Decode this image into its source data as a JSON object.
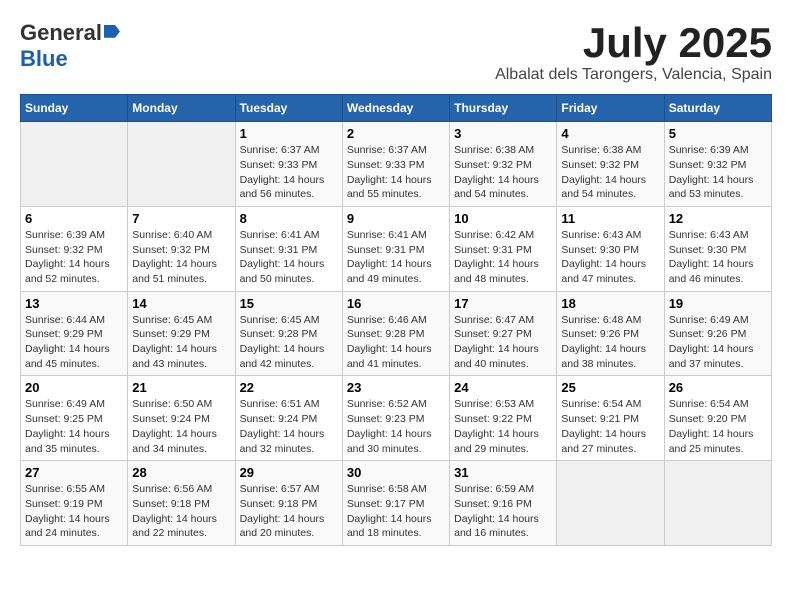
{
  "logo": {
    "general": "General",
    "blue": "Blue"
  },
  "title": {
    "month": "July 2025",
    "location": "Albalat dels Tarongers, Valencia, Spain"
  },
  "headers": [
    "Sunday",
    "Monday",
    "Tuesday",
    "Wednesday",
    "Thursday",
    "Friday",
    "Saturday"
  ],
  "weeks": [
    [
      {
        "num": "",
        "sunrise": "",
        "sunset": "",
        "daylight": "",
        "empty": true
      },
      {
        "num": "",
        "sunrise": "",
        "sunset": "",
        "daylight": "",
        "empty": true
      },
      {
        "num": "1",
        "sunrise": "Sunrise: 6:37 AM",
        "sunset": "Sunset: 9:33 PM",
        "daylight": "Daylight: 14 hours and 56 minutes.",
        "empty": false
      },
      {
        "num": "2",
        "sunrise": "Sunrise: 6:37 AM",
        "sunset": "Sunset: 9:33 PM",
        "daylight": "Daylight: 14 hours and 55 minutes.",
        "empty": false
      },
      {
        "num": "3",
        "sunrise": "Sunrise: 6:38 AM",
        "sunset": "Sunset: 9:32 PM",
        "daylight": "Daylight: 14 hours and 54 minutes.",
        "empty": false
      },
      {
        "num": "4",
        "sunrise": "Sunrise: 6:38 AM",
        "sunset": "Sunset: 9:32 PM",
        "daylight": "Daylight: 14 hours and 54 minutes.",
        "empty": false
      },
      {
        "num": "5",
        "sunrise": "Sunrise: 6:39 AM",
        "sunset": "Sunset: 9:32 PM",
        "daylight": "Daylight: 14 hours and 53 minutes.",
        "empty": false
      }
    ],
    [
      {
        "num": "6",
        "sunrise": "Sunrise: 6:39 AM",
        "sunset": "Sunset: 9:32 PM",
        "daylight": "Daylight: 14 hours and 52 minutes.",
        "empty": false
      },
      {
        "num": "7",
        "sunrise": "Sunrise: 6:40 AM",
        "sunset": "Sunset: 9:32 PM",
        "daylight": "Daylight: 14 hours and 51 minutes.",
        "empty": false
      },
      {
        "num": "8",
        "sunrise": "Sunrise: 6:41 AM",
        "sunset": "Sunset: 9:31 PM",
        "daylight": "Daylight: 14 hours and 50 minutes.",
        "empty": false
      },
      {
        "num": "9",
        "sunrise": "Sunrise: 6:41 AM",
        "sunset": "Sunset: 9:31 PM",
        "daylight": "Daylight: 14 hours and 49 minutes.",
        "empty": false
      },
      {
        "num": "10",
        "sunrise": "Sunrise: 6:42 AM",
        "sunset": "Sunset: 9:31 PM",
        "daylight": "Daylight: 14 hours and 48 minutes.",
        "empty": false
      },
      {
        "num": "11",
        "sunrise": "Sunrise: 6:43 AM",
        "sunset": "Sunset: 9:30 PM",
        "daylight": "Daylight: 14 hours and 47 minutes.",
        "empty": false
      },
      {
        "num": "12",
        "sunrise": "Sunrise: 6:43 AM",
        "sunset": "Sunset: 9:30 PM",
        "daylight": "Daylight: 14 hours and 46 minutes.",
        "empty": false
      }
    ],
    [
      {
        "num": "13",
        "sunrise": "Sunrise: 6:44 AM",
        "sunset": "Sunset: 9:29 PM",
        "daylight": "Daylight: 14 hours and 45 minutes.",
        "empty": false
      },
      {
        "num": "14",
        "sunrise": "Sunrise: 6:45 AM",
        "sunset": "Sunset: 9:29 PM",
        "daylight": "Daylight: 14 hours and 43 minutes.",
        "empty": false
      },
      {
        "num": "15",
        "sunrise": "Sunrise: 6:45 AM",
        "sunset": "Sunset: 9:28 PM",
        "daylight": "Daylight: 14 hours and 42 minutes.",
        "empty": false
      },
      {
        "num": "16",
        "sunrise": "Sunrise: 6:46 AM",
        "sunset": "Sunset: 9:28 PM",
        "daylight": "Daylight: 14 hours and 41 minutes.",
        "empty": false
      },
      {
        "num": "17",
        "sunrise": "Sunrise: 6:47 AM",
        "sunset": "Sunset: 9:27 PM",
        "daylight": "Daylight: 14 hours and 40 minutes.",
        "empty": false
      },
      {
        "num": "18",
        "sunrise": "Sunrise: 6:48 AM",
        "sunset": "Sunset: 9:26 PM",
        "daylight": "Daylight: 14 hours and 38 minutes.",
        "empty": false
      },
      {
        "num": "19",
        "sunrise": "Sunrise: 6:49 AM",
        "sunset": "Sunset: 9:26 PM",
        "daylight": "Daylight: 14 hours and 37 minutes.",
        "empty": false
      }
    ],
    [
      {
        "num": "20",
        "sunrise": "Sunrise: 6:49 AM",
        "sunset": "Sunset: 9:25 PM",
        "daylight": "Daylight: 14 hours and 35 minutes.",
        "empty": false
      },
      {
        "num": "21",
        "sunrise": "Sunrise: 6:50 AM",
        "sunset": "Sunset: 9:24 PM",
        "daylight": "Daylight: 14 hours and 34 minutes.",
        "empty": false
      },
      {
        "num": "22",
        "sunrise": "Sunrise: 6:51 AM",
        "sunset": "Sunset: 9:24 PM",
        "daylight": "Daylight: 14 hours and 32 minutes.",
        "empty": false
      },
      {
        "num": "23",
        "sunrise": "Sunrise: 6:52 AM",
        "sunset": "Sunset: 9:23 PM",
        "daylight": "Daylight: 14 hours and 30 minutes.",
        "empty": false
      },
      {
        "num": "24",
        "sunrise": "Sunrise: 6:53 AM",
        "sunset": "Sunset: 9:22 PM",
        "daylight": "Daylight: 14 hours and 29 minutes.",
        "empty": false
      },
      {
        "num": "25",
        "sunrise": "Sunrise: 6:54 AM",
        "sunset": "Sunset: 9:21 PM",
        "daylight": "Daylight: 14 hours and 27 minutes.",
        "empty": false
      },
      {
        "num": "26",
        "sunrise": "Sunrise: 6:54 AM",
        "sunset": "Sunset: 9:20 PM",
        "daylight": "Daylight: 14 hours and 25 minutes.",
        "empty": false
      }
    ],
    [
      {
        "num": "27",
        "sunrise": "Sunrise: 6:55 AM",
        "sunset": "Sunset: 9:19 PM",
        "daylight": "Daylight: 14 hours and 24 minutes.",
        "empty": false
      },
      {
        "num": "28",
        "sunrise": "Sunrise: 6:56 AM",
        "sunset": "Sunset: 9:18 PM",
        "daylight": "Daylight: 14 hours and 22 minutes.",
        "empty": false
      },
      {
        "num": "29",
        "sunrise": "Sunrise: 6:57 AM",
        "sunset": "Sunset: 9:18 PM",
        "daylight": "Daylight: 14 hours and 20 minutes.",
        "empty": false
      },
      {
        "num": "30",
        "sunrise": "Sunrise: 6:58 AM",
        "sunset": "Sunset: 9:17 PM",
        "daylight": "Daylight: 14 hours and 18 minutes.",
        "empty": false
      },
      {
        "num": "31",
        "sunrise": "Sunrise: 6:59 AM",
        "sunset": "Sunset: 9:16 PM",
        "daylight": "Daylight: 14 hours and 16 minutes.",
        "empty": false
      },
      {
        "num": "",
        "sunrise": "",
        "sunset": "",
        "daylight": "",
        "empty": true
      },
      {
        "num": "",
        "sunrise": "",
        "sunset": "",
        "daylight": "",
        "empty": true
      }
    ]
  ]
}
